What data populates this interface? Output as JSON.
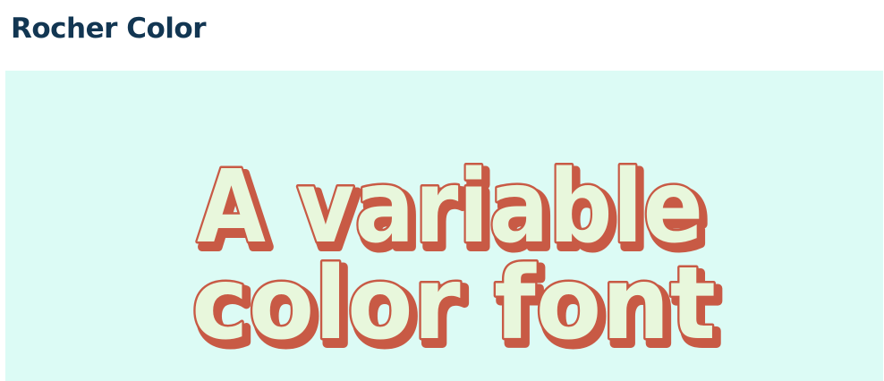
{
  "page": {
    "title": "Rocher Color"
  },
  "demo": {
    "line1": "A variable",
    "line2": "color font",
    "colors": {
      "panel_background": "#dcfbf5",
      "letter_fill": "#e8f7dc",
      "letter_outline": "#c85a45",
      "title_text": "#123652"
    }
  }
}
